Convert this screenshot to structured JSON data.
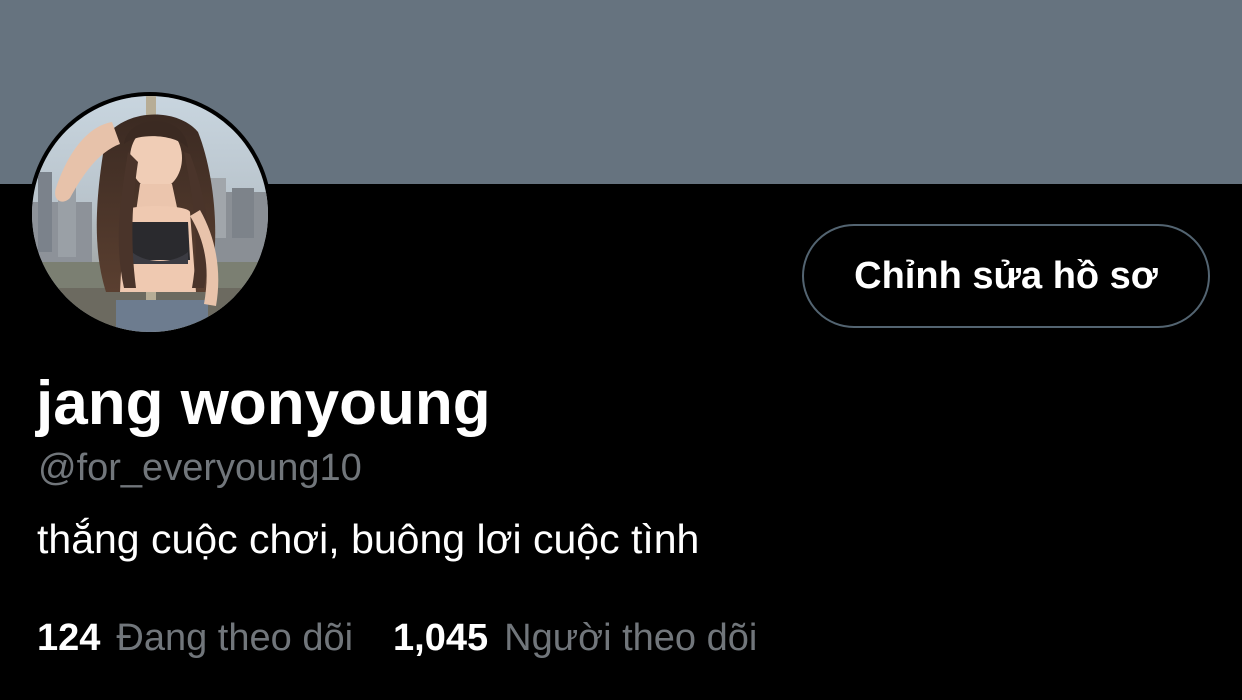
{
  "profile": {
    "display_name": "jang wonyoung",
    "handle": "@for_everyoung10",
    "bio": "thắng cuộc chơi, buông lơi cuộc tình",
    "edit_button_label": "Chỉnh sửa hồ sơ",
    "banner_color": "#66737f",
    "avatar": "profile-photo"
  },
  "stats": {
    "following": {
      "count": "124",
      "label": "Đang theo dõi"
    },
    "followers": {
      "count": "1,045",
      "label": "Người theo dõi"
    }
  },
  "colors": {
    "background": "#000000",
    "text_primary": "#ffffff",
    "text_secondary": "#71767b",
    "button_border": "#536471"
  }
}
